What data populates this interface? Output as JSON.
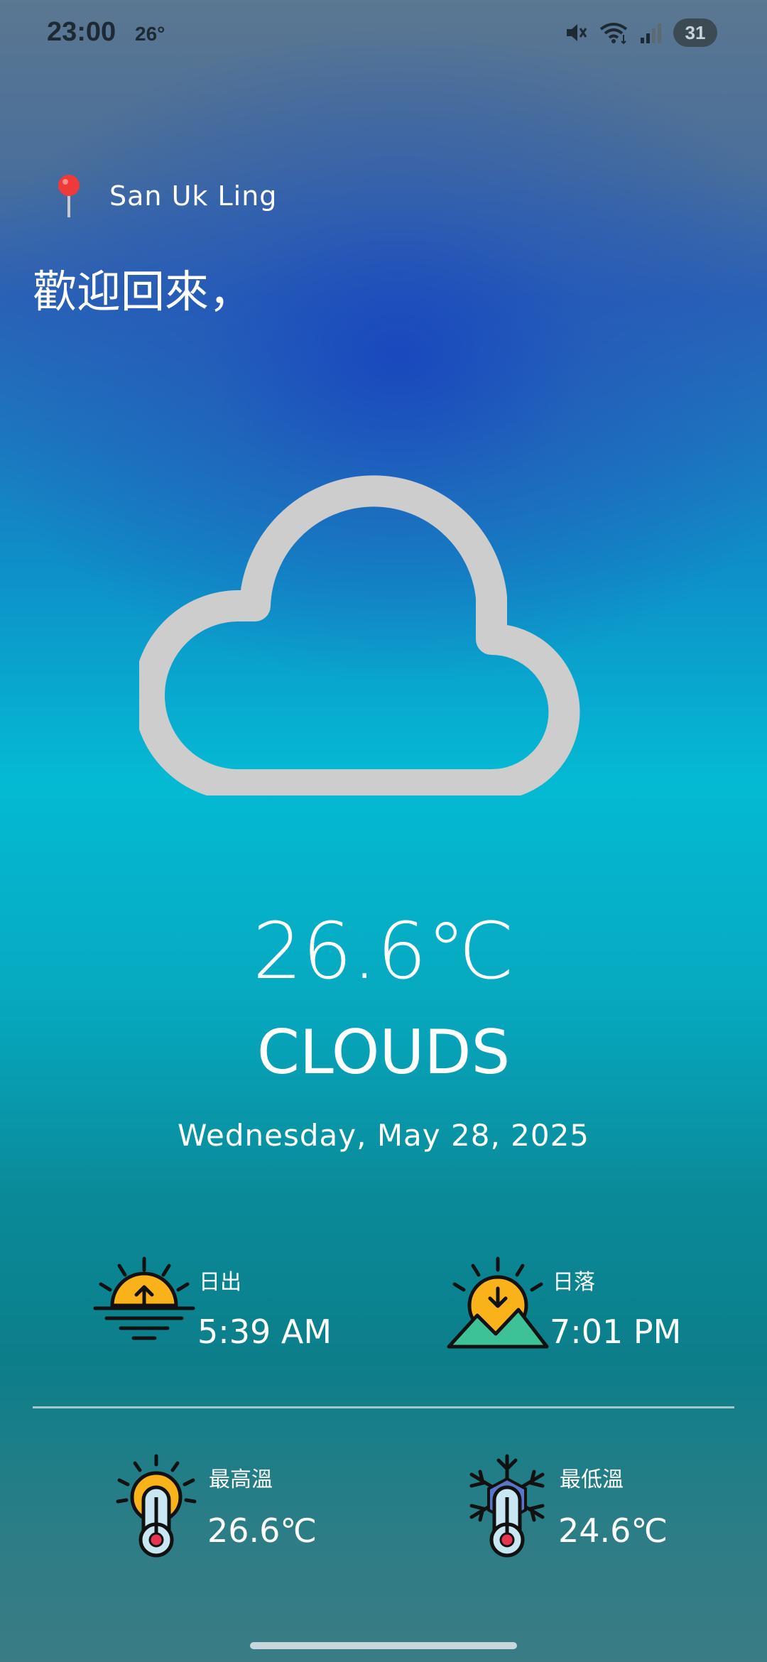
{
  "status_bar": {
    "time": "23:00",
    "temperature": "26°",
    "battery": "31",
    "icons": [
      "mute-icon",
      "wifi-icon",
      "signal-icon",
      "battery-icon"
    ]
  },
  "location": {
    "icon": "map-pin-icon",
    "name": "San Uk Ling"
  },
  "greeting": "歡迎回來，",
  "weather": {
    "icon": "cloud-icon",
    "temperature": "26.6℃",
    "condition": "CLOUDS",
    "date": "Wednesday, May 28, 2025"
  },
  "stats": {
    "sunrise": {
      "icon": "sunrise-icon",
      "label": "日出",
      "value": "5:39 AM"
    },
    "sunset": {
      "icon": "sunset-icon",
      "label": "日落",
      "value": "7:01 PM"
    },
    "max_temp": {
      "icon": "hot-thermometer-icon",
      "label": "最高溫",
      "value": "26.6℃"
    },
    "min_temp": {
      "icon": "cold-thermometer-icon",
      "label": "最低溫",
      "value": "24.6℃"
    }
  },
  "colors": {
    "sun": "#f9b21a",
    "mountain": "#3cc296",
    "thermometer_bulb": "#e7344f",
    "thermometer_glass": "#c9e6f3",
    "cloud_stroke": "#cdcdcd",
    "pin": "#ee3a3a"
  }
}
